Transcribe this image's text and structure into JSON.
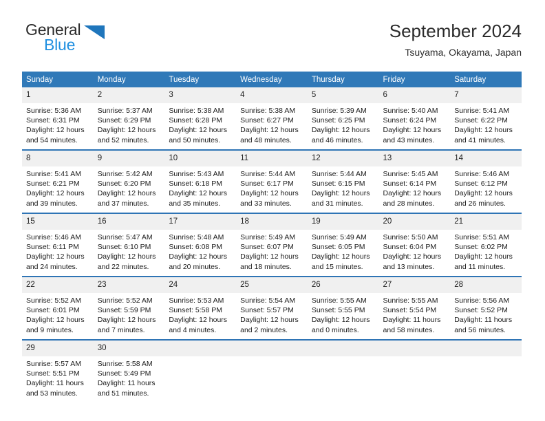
{
  "logo": {
    "word_top": "General",
    "word_bottom": "Blue",
    "triangle_color": "#1f76bc",
    "blue_text_color": "#1f8fe0"
  },
  "header": {
    "title": "September 2024",
    "subtitle": "Tsuyama, Okayama, Japan"
  },
  "theme": {
    "header_blue": "#3079b8",
    "row_border_blue": "#2e74b5",
    "daynum_gray": "#f0f0f0"
  },
  "calendar": {
    "weekday_headers": [
      "Sunday",
      "Monday",
      "Tuesday",
      "Wednesday",
      "Thursday",
      "Friday",
      "Saturday"
    ],
    "weeks": [
      [
        {
          "day": "1",
          "sunrise": "Sunrise: 5:36 AM",
          "sunset": "Sunset: 6:31 PM",
          "daylight_1": "Daylight: 12 hours",
          "daylight_2": "and 54 minutes."
        },
        {
          "day": "2",
          "sunrise": "Sunrise: 5:37 AM",
          "sunset": "Sunset: 6:29 PM",
          "daylight_1": "Daylight: 12 hours",
          "daylight_2": "and 52 minutes."
        },
        {
          "day": "3",
          "sunrise": "Sunrise: 5:38 AM",
          "sunset": "Sunset: 6:28 PM",
          "daylight_1": "Daylight: 12 hours",
          "daylight_2": "and 50 minutes."
        },
        {
          "day": "4",
          "sunrise": "Sunrise: 5:38 AM",
          "sunset": "Sunset: 6:27 PM",
          "daylight_1": "Daylight: 12 hours",
          "daylight_2": "and 48 minutes."
        },
        {
          "day": "5",
          "sunrise": "Sunrise: 5:39 AM",
          "sunset": "Sunset: 6:25 PM",
          "daylight_1": "Daylight: 12 hours",
          "daylight_2": "and 46 minutes."
        },
        {
          "day": "6",
          "sunrise": "Sunrise: 5:40 AM",
          "sunset": "Sunset: 6:24 PM",
          "daylight_1": "Daylight: 12 hours",
          "daylight_2": "and 43 minutes."
        },
        {
          "day": "7",
          "sunrise": "Sunrise: 5:41 AM",
          "sunset": "Sunset: 6:22 PM",
          "daylight_1": "Daylight: 12 hours",
          "daylight_2": "and 41 minutes."
        }
      ],
      [
        {
          "day": "8",
          "sunrise": "Sunrise: 5:41 AM",
          "sunset": "Sunset: 6:21 PM",
          "daylight_1": "Daylight: 12 hours",
          "daylight_2": "and 39 minutes."
        },
        {
          "day": "9",
          "sunrise": "Sunrise: 5:42 AM",
          "sunset": "Sunset: 6:20 PM",
          "daylight_1": "Daylight: 12 hours",
          "daylight_2": "and 37 minutes."
        },
        {
          "day": "10",
          "sunrise": "Sunrise: 5:43 AM",
          "sunset": "Sunset: 6:18 PM",
          "daylight_1": "Daylight: 12 hours",
          "daylight_2": "and 35 minutes."
        },
        {
          "day": "11",
          "sunrise": "Sunrise: 5:44 AM",
          "sunset": "Sunset: 6:17 PM",
          "daylight_1": "Daylight: 12 hours",
          "daylight_2": "and 33 minutes."
        },
        {
          "day": "12",
          "sunrise": "Sunrise: 5:44 AM",
          "sunset": "Sunset: 6:15 PM",
          "daylight_1": "Daylight: 12 hours",
          "daylight_2": "and 31 minutes."
        },
        {
          "day": "13",
          "sunrise": "Sunrise: 5:45 AM",
          "sunset": "Sunset: 6:14 PM",
          "daylight_1": "Daylight: 12 hours",
          "daylight_2": "and 28 minutes."
        },
        {
          "day": "14",
          "sunrise": "Sunrise: 5:46 AM",
          "sunset": "Sunset: 6:12 PM",
          "daylight_1": "Daylight: 12 hours",
          "daylight_2": "and 26 minutes."
        }
      ],
      [
        {
          "day": "15",
          "sunrise": "Sunrise: 5:46 AM",
          "sunset": "Sunset: 6:11 PM",
          "daylight_1": "Daylight: 12 hours",
          "daylight_2": "and 24 minutes."
        },
        {
          "day": "16",
          "sunrise": "Sunrise: 5:47 AM",
          "sunset": "Sunset: 6:10 PM",
          "daylight_1": "Daylight: 12 hours",
          "daylight_2": "and 22 minutes."
        },
        {
          "day": "17",
          "sunrise": "Sunrise: 5:48 AM",
          "sunset": "Sunset: 6:08 PM",
          "daylight_1": "Daylight: 12 hours",
          "daylight_2": "and 20 minutes."
        },
        {
          "day": "18",
          "sunrise": "Sunrise: 5:49 AM",
          "sunset": "Sunset: 6:07 PM",
          "daylight_1": "Daylight: 12 hours",
          "daylight_2": "and 18 minutes."
        },
        {
          "day": "19",
          "sunrise": "Sunrise: 5:49 AM",
          "sunset": "Sunset: 6:05 PM",
          "daylight_1": "Daylight: 12 hours",
          "daylight_2": "and 15 minutes."
        },
        {
          "day": "20",
          "sunrise": "Sunrise: 5:50 AM",
          "sunset": "Sunset: 6:04 PM",
          "daylight_1": "Daylight: 12 hours",
          "daylight_2": "and 13 minutes."
        },
        {
          "day": "21",
          "sunrise": "Sunrise: 5:51 AM",
          "sunset": "Sunset: 6:02 PM",
          "daylight_1": "Daylight: 12 hours",
          "daylight_2": "and 11 minutes."
        }
      ],
      [
        {
          "day": "22",
          "sunrise": "Sunrise: 5:52 AM",
          "sunset": "Sunset: 6:01 PM",
          "daylight_1": "Daylight: 12 hours",
          "daylight_2": "and 9 minutes."
        },
        {
          "day": "23",
          "sunrise": "Sunrise: 5:52 AM",
          "sunset": "Sunset: 5:59 PM",
          "daylight_1": "Daylight: 12 hours",
          "daylight_2": "and 7 minutes."
        },
        {
          "day": "24",
          "sunrise": "Sunrise: 5:53 AM",
          "sunset": "Sunset: 5:58 PM",
          "daylight_1": "Daylight: 12 hours",
          "daylight_2": "and 4 minutes."
        },
        {
          "day": "25",
          "sunrise": "Sunrise: 5:54 AM",
          "sunset": "Sunset: 5:57 PM",
          "daylight_1": "Daylight: 12 hours",
          "daylight_2": "and 2 minutes."
        },
        {
          "day": "26",
          "sunrise": "Sunrise: 5:55 AM",
          "sunset": "Sunset: 5:55 PM",
          "daylight_1": "Daylight: 12 hours",
          "daylight_2": "and 0 minutes."
        },
        {
          "day": "27",
          "sunrise": "Sunrise: 5:55 AM",
          "sunset": "Sunset: 5:54 PM",
          "daylight_1": "Daylight: 11 hours",
          "daylight_2": "and 58 minutes."
        },
        {
          "day": "28",
          "sunrise": "Sunrise: 5:56 AM",
          "sunset": "Sunset: 5:52 PM",
          "daylight_1": "Daylight: 11 hours",
          "daylight_2": "and 56 minutes."
        }
      ],
      [
        {
          "day": "29",
          "sunrise": "Sunrise: 5:57 AM",
          "sunset": "Sunset: 5:51 PM",
          "daylight_1": "Daylight: 11 hours",
          "daylight_2": "and 53 minutes."
        },
        {
          "day": "30",
          "sunrise": "Sunrise: 5:58 AM",
          "sunset": "Sunset: 5:49 PM",
          "daylight_1": "Daylight: 11 hours",
          "daylight_2": "and 51 minutes."
        },
        {
          "day": "",
          "sunrise": "",
          "sunset": "",
          "daylight_1": "",
          "daylight_2": ""
        },
        {
          "day": "",
          "sunrise": "",
          "sunset": "",
          "daylight_1": "",
          "daylight_2": ""
        },
        {
          "day": "",
          "sunrise": "",
          "sunset": "",
          "daylight_1": "",
          "daylight_2": ""
        },
        {
          "day": "",
          "sunrise": "",
          "sunset": "",
          "daylight_1": "",
          "daylight_2": ""
        },
        {
          "day": "",
          "sunrise": "",
          "sunset": "",
          "daylight_1": "",
          "daylight_2": ""
        }
      ]
    ]
  }
}
